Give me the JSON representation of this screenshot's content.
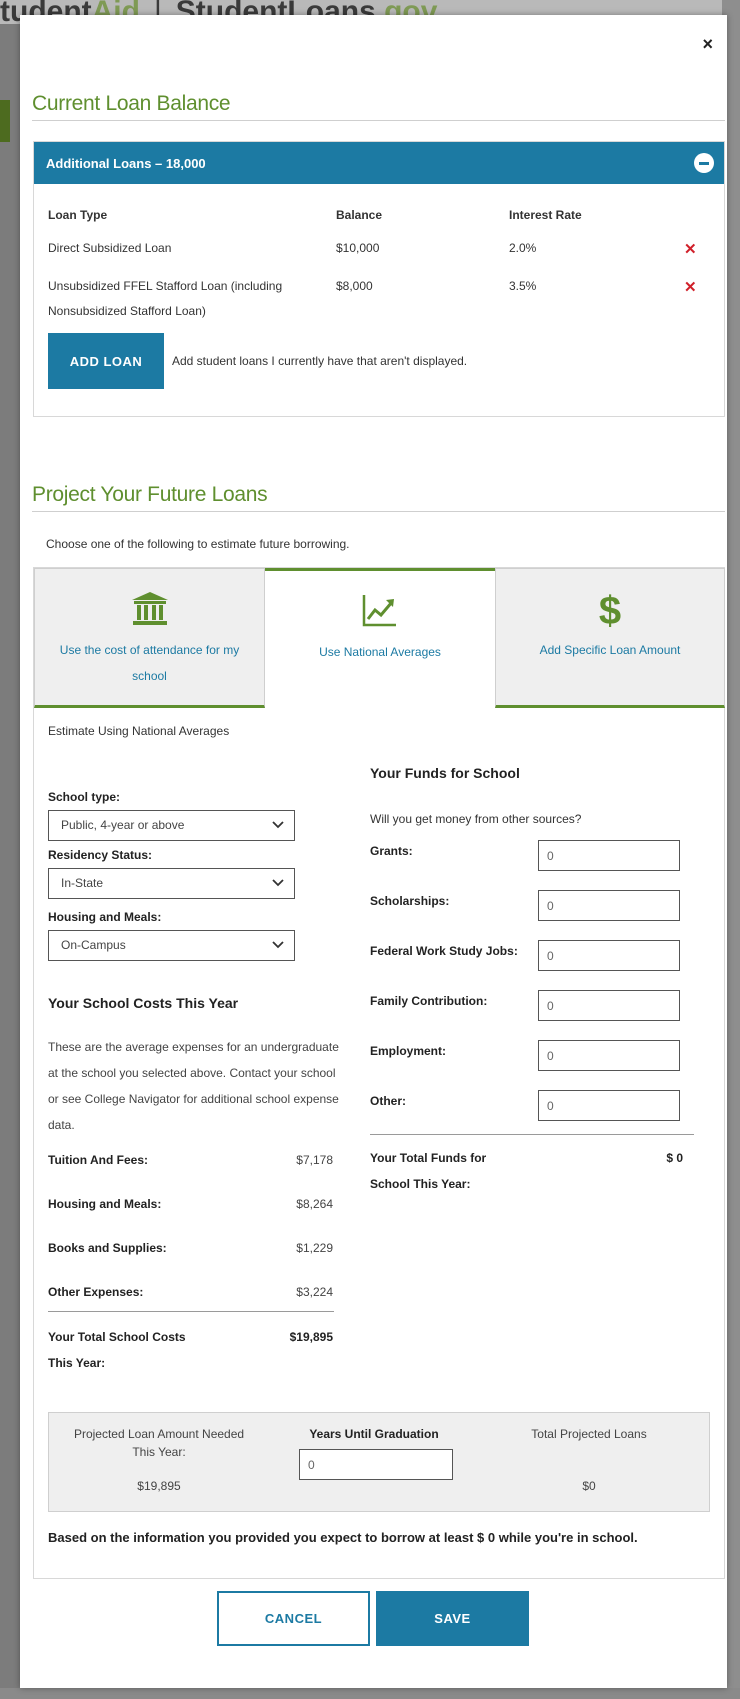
{
  "background": {
    "site_left": "tudent",
    "site_left_accent": "Aid",
    "site_right": "StudentLoans",
    "site_right_accent": ".gov"
  },
  "colors": {
    "accent_blue": "#1c7aa3",
    "accent_green": "#5f8f2f",
    "delete_red": "#d0202a"
  },
  "modal": {
    "close_label": "×",
    "current_balance": {
      "title": "Current Loan Balance",
      "panel_header": "Additional Loans – 18,000",
      "columns": [
        "Loan Type",
        "Balance",
        "Interest Rate"
      ],
      "loans": [
        {
          "type": "Direct Subsidized Loan",
          "type_line2": "",
          "balance": "$10,000",
          "rate": "2.0%"
        },
        {
          "type": "Unsubsidized FFEL Stafford Loan (including",
          "type_line2": "Nonsubsidized Stafford Loan)",
          "balance": "$8,000",
          "rate": "3.5%"
        }
      ],
      "delete_glyph": "✕",
      "add_loan_label": "ADD LOAN",
      "add_loan_note": "Add student loans I currently have that aren't displayed."
    },
    "future_loans": {
      "title": "Project Your Future Loans",
      "choose_text": "Choose one of the following to estimate future borrowing.",
      "tabs": [
        {
          "label_line1": "Use the cost of attendance for my",
          "label_line2": "school",
          "icon": "bank-icon"
        },
        {
          "label_line1": "Use National Averages",
          "label_line2": "",
          "icon": "chart-trend-icon"
        },
        {
          "label_line1": "Add Specific Loan Amount",
          "label_line2": "",
          "icon": "dollar-icon"
        }
      ],
      "dollar_glyph": "$",
      "estimate_label": "Estimate Using National Averages",
      "school_type_label": "School type:",
      "school_type_value": "Public, 4-year or above",
      "residency_label": "Residency Status:",
      "residency_value": "In-State",
      "housing_label": "Housing and Meals:",
      "housing_value": "On-Campus",
      "costs_title": "Your School Costs This Year",
      "costs_paragraph": "These are the average expenses for an undergraduate at the school you selected above. Contact your school or see College Navigator for additional school expense data.",
      "costs": [
        {
          "label": "Tuition And Fees:",
          "value": "$7,178"
        },
        {
          "label": "Housing and Meals:",
          "value": "$8,264"
        },
        {
          "label": "Books and Supplies:",
          "value": "$1,229"
        },
        {
          "label": "Other Expenses:",
          "value": "$3,224"
        }
      ],
      "total_costs_label_line1": "Your Total School Costs",
      "total_costs_label_line2": "This Year:",
      "total_costs_value": "$19,895",
      "funds_title": "Your Funds for School",
      "funds_question": "Will you get money from other sources?",
      "funds": [
        {
          "label": "Grants:",
          "value": "0"
        },
        {
          "label": "Scholarships:",
          "value": "0"
        },
        {
          "label": "Federal Work Study Jobs:",
          "value": "0"
        },
        {
          "label": "Family Contribution:",
          "value": "0"
        },
        {
          "label": "Employment:",
          "value": "0"
        },
        {
          "label": "Other:",
          "value": "0"
        }
      ],
      "total_funds_label_line1": "Your Total Funds for",
      "total_funds_label_line2": "School This Year:",
      "total_funds_value": "$ 0",
      "projection": {
        "needed_label_line1": "Projected Loan Amount Needed",
        "needed_label_line2": "This Year:",
        "needed_value": "$19,895",
        "years_label": "Years Until Graduation",
        "years_value": "0",
        "total_label": "Total Projected Loans",
        "total_value": "$0"
      },
      "summary": "Based on the information you provided you expect to borrow at least $ 0 while you're in school."
    },
    "cancel_label": "CANCEL",
    "save_label": "SAVE"
  }
}
